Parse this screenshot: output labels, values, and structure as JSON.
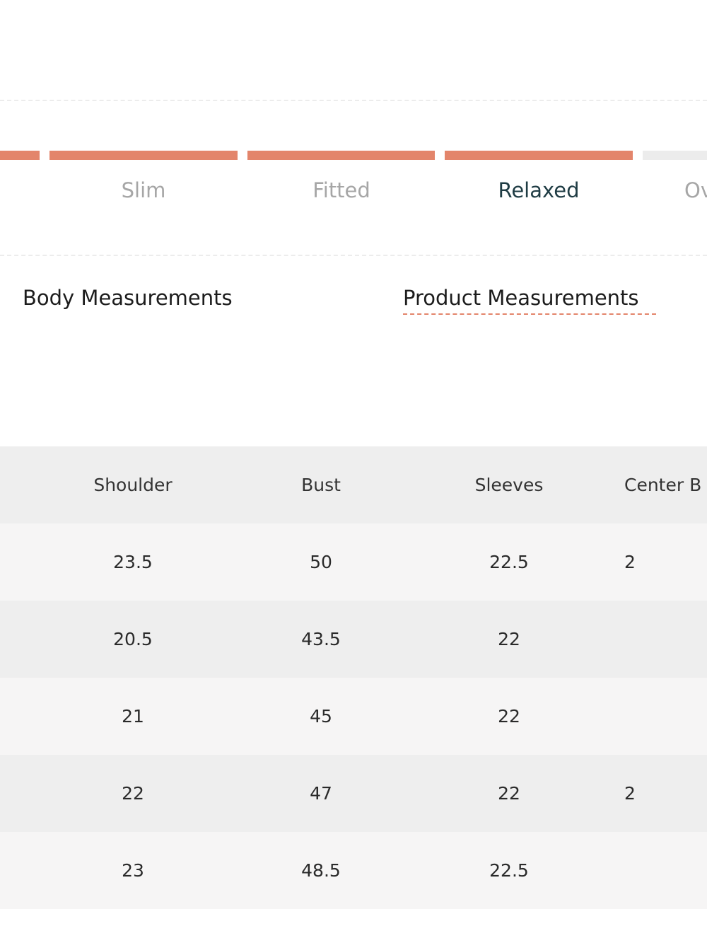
{
  "fit_scale": {
    "accent_color": "#e3856b",
    "inactive_color": "#ececec",
    "options": [
      {
        "label": "",
        "active": false,
        "filled": true
      },
      {
        "label": "Slim",
        "active": false,
        "filled": true
      },
      {
        "label": "Fitted",
        "active": false,
        "filled": true
      },
      {
        "label": "Relaxed",
        "active": true,
        "filled": true
      },
      {
        "label": "Ov",
        "active": false,
        "filled": false
      }
    ]
  },
  "tabs": {
    "body": "Body Measurements",
    "product": "Product Measurements",
    "selected": "product"
  },
  "table": {
    "columns": [
      "Shoulder",
      "Bust",
      "Sleeves",
      "Center B"
    ],
    "rows": [
      [
        "23.5",
        "50",
        "22.5",
        "2"
      ],
      [
        "20.5",
        "43.5",
        "22",
        ""
      ],
      [
        "21",
        "45",
        "22",
        ""
      ],
      [
        "22",
        "47",
        "22",
        "2"
      ],
      [
        "23",
        "48.5",
        "22.5",
        ""
      ]
    ]
  }
}
